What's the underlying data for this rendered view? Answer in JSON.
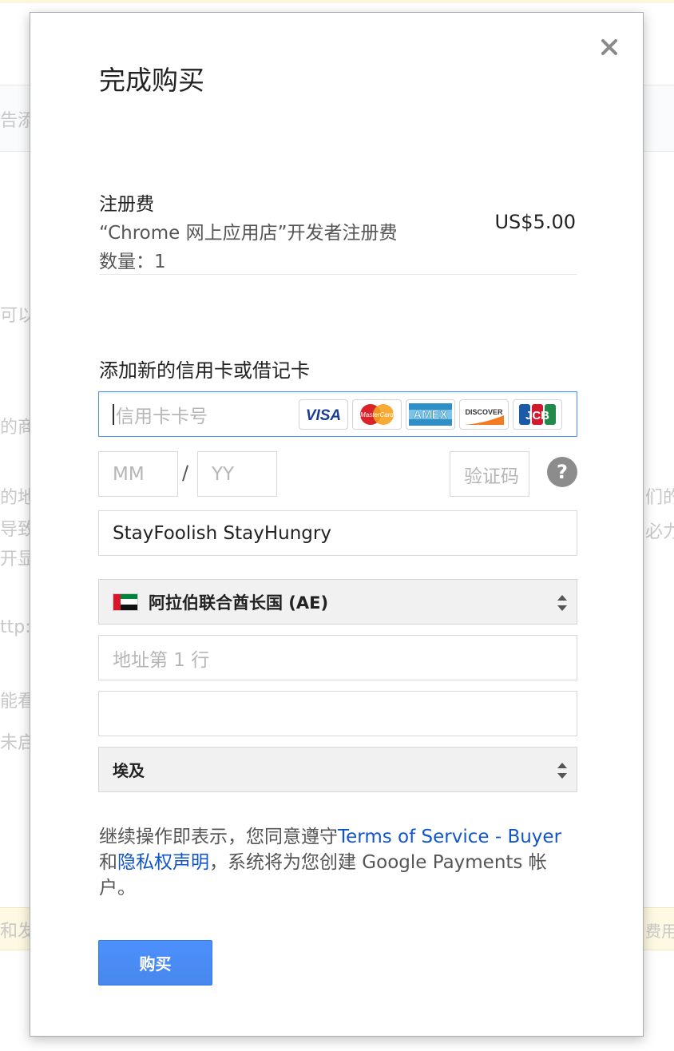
{
  "background": {
    "fragments": [
      "告添加",
      "可以",
      "的商",
      "的地",
      "导致",
      "开显",
      "ttp:/",
      "能看",
      "未启用",
      "和发",
      "们的",
      "必力",
      "费用"
    ]
  },
  "dialog": {
    "title": "完成购买",
    "close_icon": "close-icon",
    "item": {
      "name": "注册费",
      "description": "“Chrome 网上应用店”开发者注册费",
      "quantity": "数量：1",
      "price": "US$5.00"
    },
    "payment": {
      "section_title": "添加新的信用卡或借记卡",
      "card_number_placeholder": "信用卡卡号",
      "card_logos": [
        "VISA",
        "MasterCard",
        "AMEX",
        "DISCOVER",
        "JCB"
      ],
      "expiry_month_placeholder": "MM",
      "expiry_separator": "/",
      "expiry_year_placeholder": "YY",
      "cvc_placeholder": "验证码",
      "help_label": "?",
      "cardholder_name": "StayFoolish StayHungry",
      "country": "阿拉伯联合酋长国 (AE)",
      "address_line1_placeholder": "地址第 1 行",
      "address_line2_value": "",
      "region": "埃及"
    },
    "terms": {
      "prefix": "继续操作即表示，您同意遵守",
      "tos_link": "Terms of Service - Buyer",
      "and": "和",
      "privacy_link": "隐私权声明",
      "suffix": "，系统将为您创建 Google Payments 帐户。"
    },
    "buy_button": "购买"
  },
  "colors": {
    "accent": "#4d90fe",
    "link": "#1155cc",
    "focus_border": "#4d90fe"
  }
}
